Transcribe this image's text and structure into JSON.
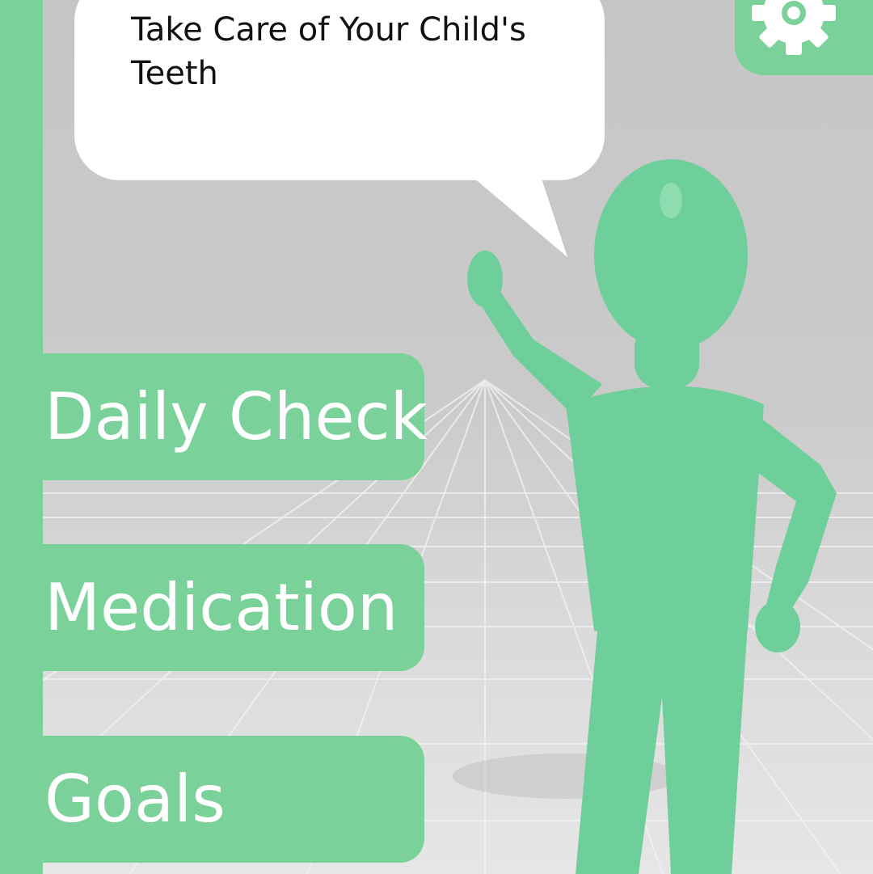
{
  "speech_bubble": {
    "text": "Take Care of Your Child's Teeth"
  },
  "settings": {
    "icon": "gear-icon"
  },
  "menu": {
    "items": [
      {
        "label": "Daily Check"
      },
      {
        "label": "Medication"
      },
      {
        "label": "Goals"
      }
    ]
  },
  "colors": {
    "accent": "#7bd19a",
    "avatar": "#6fcf9a",
    "bubble": "#ffffff",
    "background": "#c9c9c9"
  }
}
